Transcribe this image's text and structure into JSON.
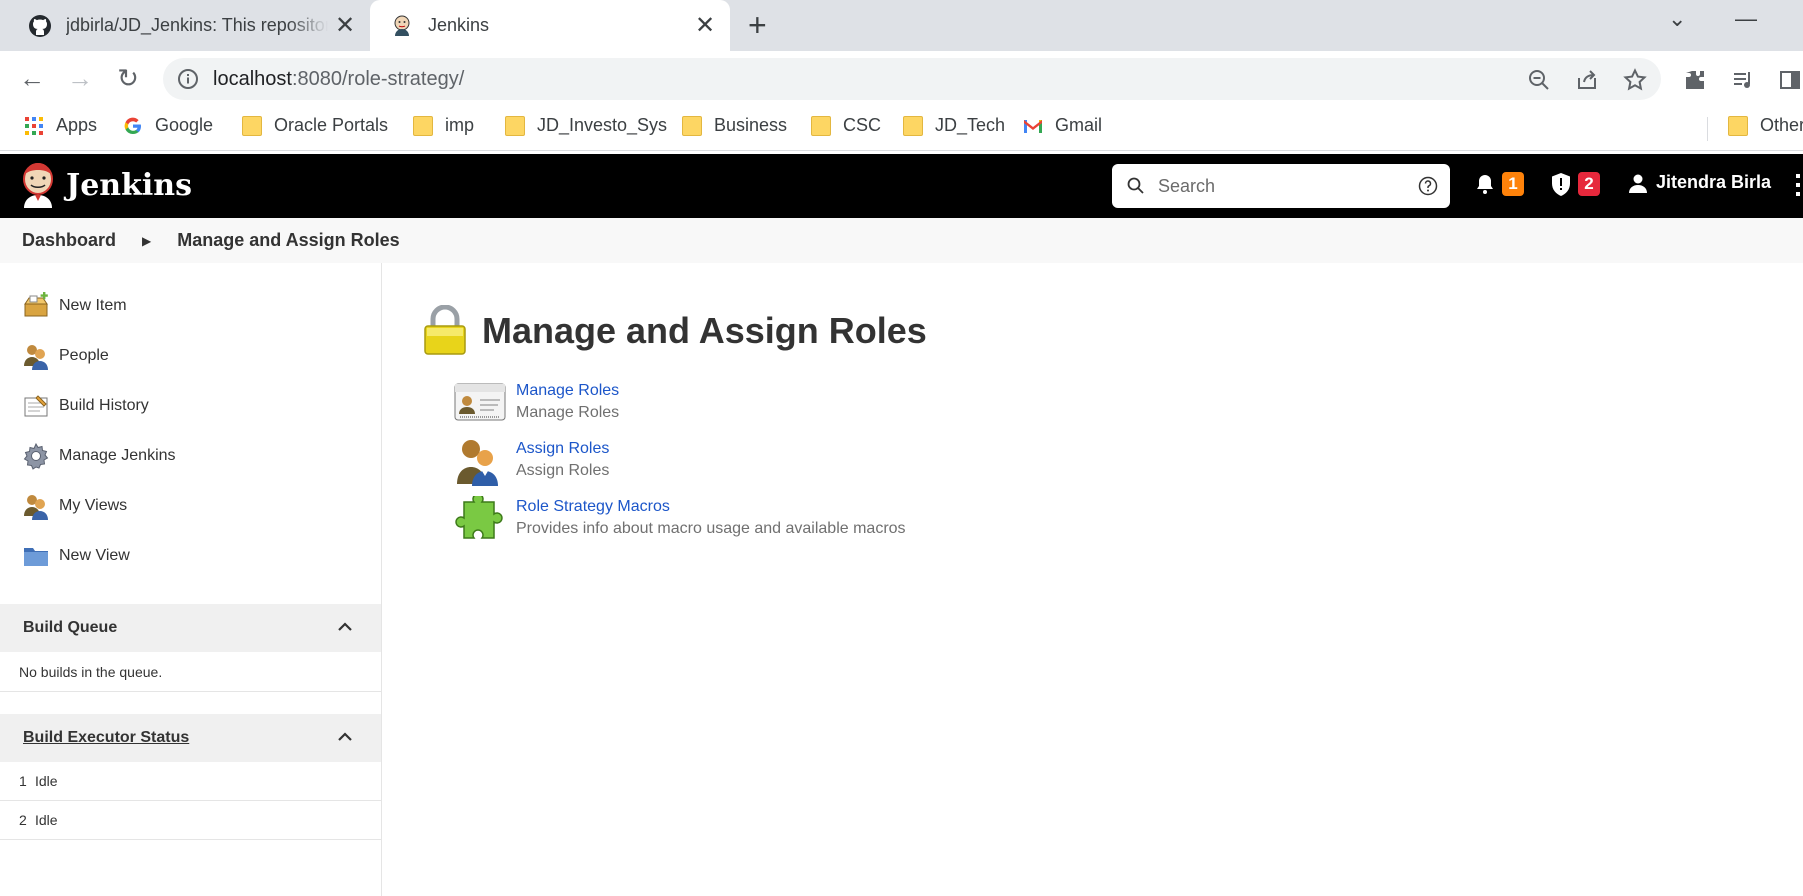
{
  "browser": {
    "tabs": [
      {
        "title": "jdbirla/JD_Jenkins: This repository",
        "icon": "github-icon",
        "active": false
      },
      {
        "title": "Jenkins",
        "icon": "jenkins-icon",
        "active": true
      }
    ],
    "url_host": "localhost",
    "url_path": ":8080/role-strategy/",
    "bookmarks": [
      "Apps",
      "Google",
      "Oracle Portals",
      "imp",
      "JD_Investo_Sys",
      "Business",
      "CSC",
      "JD_Tech",
      "Gmail",
      "Other"
    ]
  },
  "header": {
    "brand": "Jenkins",
    "search_placeholder": "Search",
    "notifications_count": "1",
    "security_count": "2",
    "user": "Jitendra Birla"
  },
  "breadcrumb": {
    "items": [
      "Dashboard",
      "Manage and Assign Roles"
    ]
  },
  "sidebar": {
    "tasks": [
      {
        "label": "New Item",
        "icon": "new-item-icon"
      },
      {
        "label": "People",
        "icon": "people-icon"
      },
      {
        "label": "Build History",
        "icon": "build-history-icon"
      },
      {
        "label": "Manage Jenkins",
        "icon": "gear-icon"
      },
      {
        "label": "My Views",
        "icon": "my-views-icon"
      },
      {
        "label": "New View",
        "icon": "folder-icon"
      }
    ],
    "build_queue": {
      "title": "Build Queue",
      "empty_text": "No builds in the queue."
    },
    "executors": {
      "title": "Build Executor Status",
      "rows": [
        {
          "num": "1",
          "status": "Idle"
        },
        {
          "num": "2",
          "status": "Idle"
        }
      ]
    }
  },
  "main": {
    "title": "Manage and Assign Roles",
    "items": [
      {
        "link": "Manage Roles",
        "desc": "Manage Roles",
        "icon": "id-card-icon"
      },
      {
        "link": "Assign Roles",
        "desc": "Assign Roles",
        "icon": "users-icon"
      },
      {
        "link": "Role Strategy Macros",
        "desc": "Provides info about macro usage and available macros",
        "icon": "puzzle-icon"
      }
    ]
  },
  "colors": {
    "link": "#1c56c9",
    "header_bg": "#000000",
    "notification_badge": "#fe820a",
    "security_badge": "#e6283c"
  }
}
